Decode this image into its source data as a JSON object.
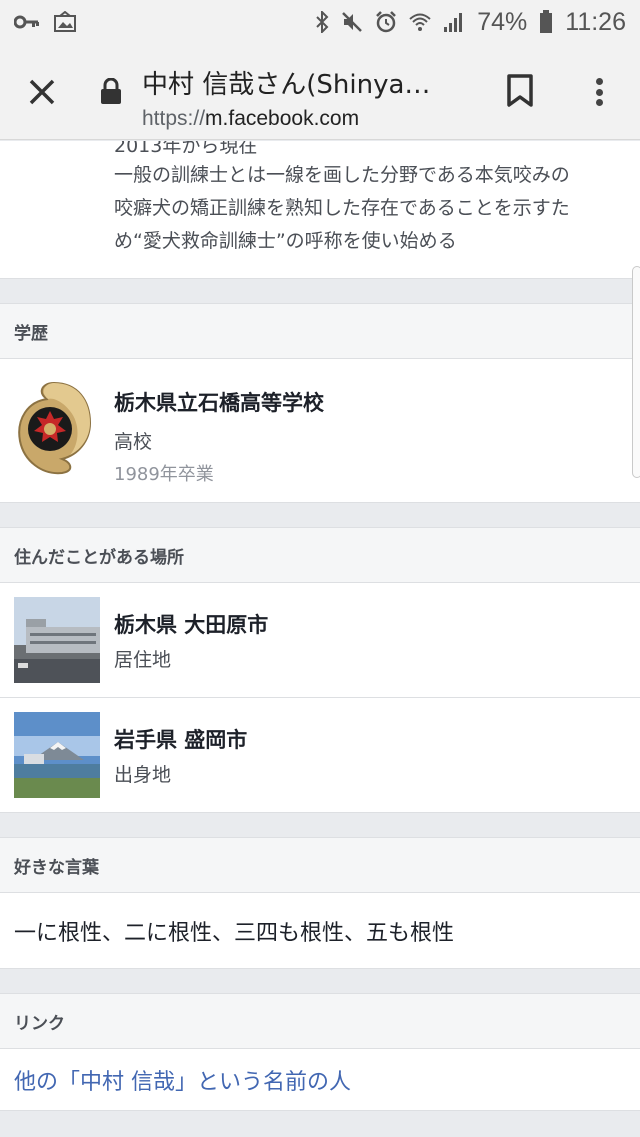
{
  "status_bar": {
    "battery": "74%",
    "time": "11:26",
    "icons": [
      "key-icon",
      "image-notification-icon",
      "bluetooth-icon",
      "mute-icon",
      "alarm-icon",
      "wifi-icon",
      "signal-icon",
      "battery-icon"
    ]
  },
  "browser": {
    "title": "中村 信哉さん(Shinya…",
    "url_scheme": "https://",
    "url_host": "m.facebook.com"
  },
  "work": {
    "years": "2013年から現在",
    "description_lines": [
      "一般の訓練士とは一線を画した分野である本気咬みの",
      "咬癖犬の矯正訓練を熟知した存在であることを示すた",
      "め“愛犬救命訓練士”の呼称を使い始める"
    ]
  },
  "education": {
    "header": "学歴",
    "school_name": "栃木県立石橋高等学校",
    "school_type": "高校",
    "graduation": "1989年卒業"
  },
  "places": {
    "header": "住んだことがある場所",
    "items": [
      {
        "name": "栃木県 大田原市",
        "type": "居住地"
      },
      {
        "name": "岩手県 盛岡市",
        "type": "出身地"
      }
    ]
  },
  "quotes": {
    "header": "好きな言葉",
    "text": "一に根性、二に根性、三四も根性、五も根性"
  },
  "links": {
    "header": "リンク",
    "other_people": "他の「中村 信哉」という名前の人"
  },
  "colors": {
    "link": "#4267b2",
    "background": "#e9ebee",
    "section_header": "#f5f6f7"
  }
}
